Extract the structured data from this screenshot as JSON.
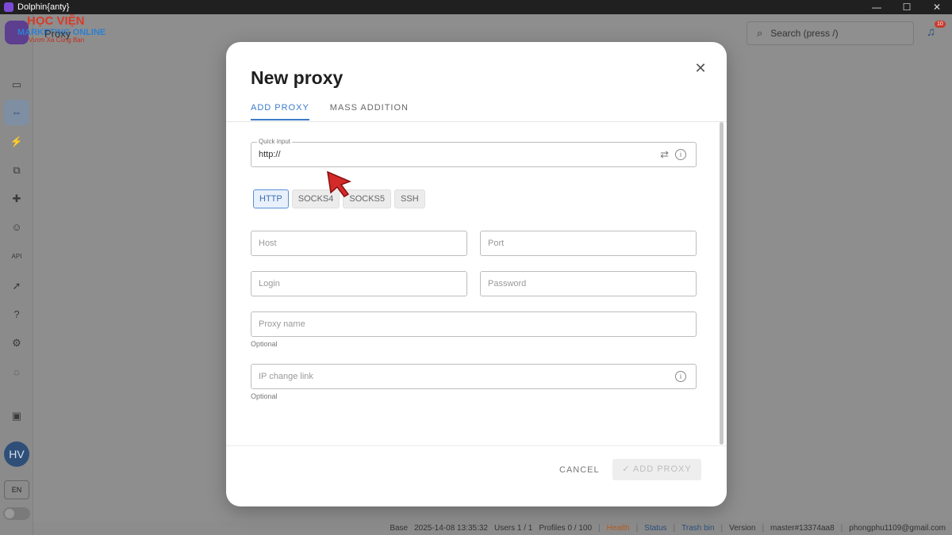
{
  "window": {
    "title": "Dolphin{anty}",
    "minimize": "—",
    "maximize": "☐",
    "close": "✕"
  },
  "brand": {
    "line1": "HỌC VIỆN",
    "line2": "MARKETING ONLINE",
    "line3": "Vươn Xa Cùng Bạn"
  },
  "header": {
    "page_title": "Proxy",
    "search_placeholder": "Search (press /)",
    "notification_count": "10"
  },
  "sidebar": {
    "avatar_initials": "HV",
    "language": "EN"
  },
  "modal": {
    "title": "New proxy",
    "tabs": [
      {
        "label": "ADD PROXY",
        "active": true
      },
      {
        "label": "MASS ADDITION",
        "active": false
      }
    ],
    "quick_input": {
      "label": "Quick input",
      "value": "http://"
    },
    "proxy_types": [
      {
        "label": "HTTP",
        "active": true
      },
      {
        "label": "SOCKS4",
        "active": false
      },
      {
        "label": "SOCKS5",
        "active": false
      },
      {
        "label": "SSH",
        "active": false
      }
    ],
    "host_placeholder": "Host",
    "port_placeholder": "Port",
    "login_placeholder": "Login",
    "password_placeholder": "Password",
    "proxy_name_placeholder": "Proxy name",
    "proxy_name_helper": "Optional",
    "ip_change_placeholder": "IP change link",
    "ip_change_helper": "Optional",
    "cancel_label": "CANCEL",
    "add_label": "✓ ADD PROXY"
  },
  "statusbar": {
    "base": "Base",
    "datetime": "2025-14-08 13:35:32",
    "users": "Users 1 / 1",
    "profiles": "Profiles 0 / 100",
    "health": "Health",
    "status": "Status",
    "trash": "Trash bin",
    "version": "Version",
    "build": "master#13374aa8",
    "email": "phongphu1109@gmail.com"
  },
  "colors": {
    "accent": "#3b7bc8",
    "badge": "#c6392c",
    "cursor": "#d42a2a"
  }
}
